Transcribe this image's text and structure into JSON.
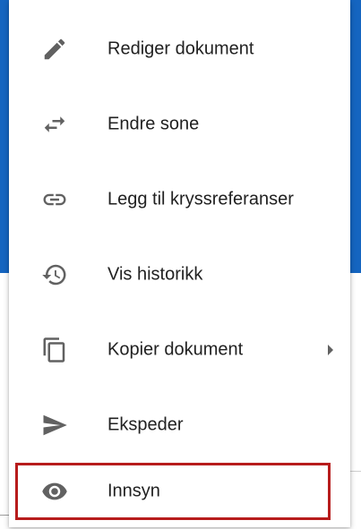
{
  "menu": {
    "items": [
      {
        "label": "Rediger dokument",
        "icon": "pencil-icon"
      },
      {
        "label": "Endre sone",
        "icon": "swap-arrows-icon"
      },
      {
        "label": "Legg til kryssreferanser",
        "icon": "link-icon"
      },
      {
        "label": "Vis historikk",
        "icon": "history-icon"
      },
      {
        "label": "Kopier dokument",
        "icon": "copy-icon",
        "has_submenu": true
      },
      {
        "label": "Ekspeder",
        "icon": "send-icon"
      },
      {
        "label": "Innsyn",
        "icon": "eye-icon",
        "highlighted": true
      }
    ]
  },
  "colors": {
    "accent": "#1565c0",
    "highlight_border": "#b71c1c",
    "icon": "#616161",
    "text": "#212121"
  }
}
